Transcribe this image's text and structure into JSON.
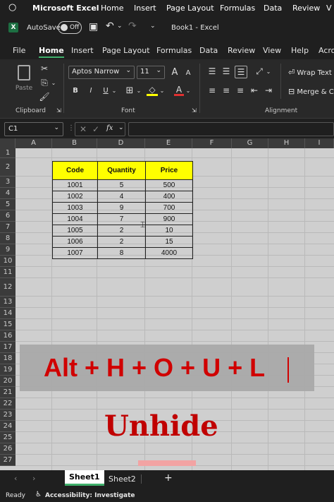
{
  "titlebar": {
    "app": "Microsoft Excel",
    "menus": [
      "Home",
      "Insert",
      "Page Layout",
      "Formulas",
      "Data",
      "Review",
      "V"
    ]
  },
  "qat": {
    "autosave_label": "AutoSave",
    "toggle_state": "Off",
    "book_title": "Book1 - Excel"
  },
  "ribbon_tabs": [
    "File",
    "Home",
    "Insert",
    "Page Layout",
    "Formulas",
    "Data",
    "Review",
    "View",
    "Help",
    "Acro"
  ],
  "ribbon": {
    "paste_label": "Paste",
    "font_name": "Aptos Narrow",
    "font_size": "11",
    "wrap_text": "Wrap Text",
    "merge_center": "Merge & C",
    "groups": {
      "clipboard": "Clipboard",
      "font": "Font",
      "alignment": "Alignment"
    },
    "bold": "B",
    "italic": "I",
    "underline": "U",
    "grow": "A",
    "shrink": "A"
  },
  "formulabar": {
    "name_box": "C1",
    "fx": "fx"
  },
  "columns": [
    "A",
    "B",
    "D",
    "E",
    "F",
    "G",
    "H",
    "I"
  ],
  "rows": [
    "1",
    "2",
    "3",
    "4",
    "5",
    "6",
    "7",
    "8",
    "9",
    "10",
    "11",
    "12",
    "13",
    "14",
    "15",
    "16",
    "17",
    "18",
    "19",
    "20",
    "21",
    "22",
    "23",
    "24",
    "25",
    "26",
    "27"
  ],
  "table": {
    "headers": [
      "Code",
      "Quantity",
      "Price"
    ],
    "rows": [
      [
        "1001",
        "5",
        "500"
      ],
      [
        "1002",
        "4",
        "400"
      ],
      [
        "1003",
        "9",
        "700"
      ],
      [
        "1004",
        "7",
        "900"
      ],
      [
        "1005",
        "2",
        "10"
      ],
      [
        "1006",
        "2",
        "15"
      ],
      [
        "1007",
        "8",
        "4000"
      ]
    ]
  },
  "overlay": {
    "shortcut": "Alt + H + O + U + L",
    "caption": "Unhide"
  },
  "sheet_tabs": [
    "Sheet1",
    "Sheet2"
  ],
  "add_sheet": "+",
  "status": {
    "ready": "Ready",
    "accessibility": "Accessibility: Investigate"
  }
}
